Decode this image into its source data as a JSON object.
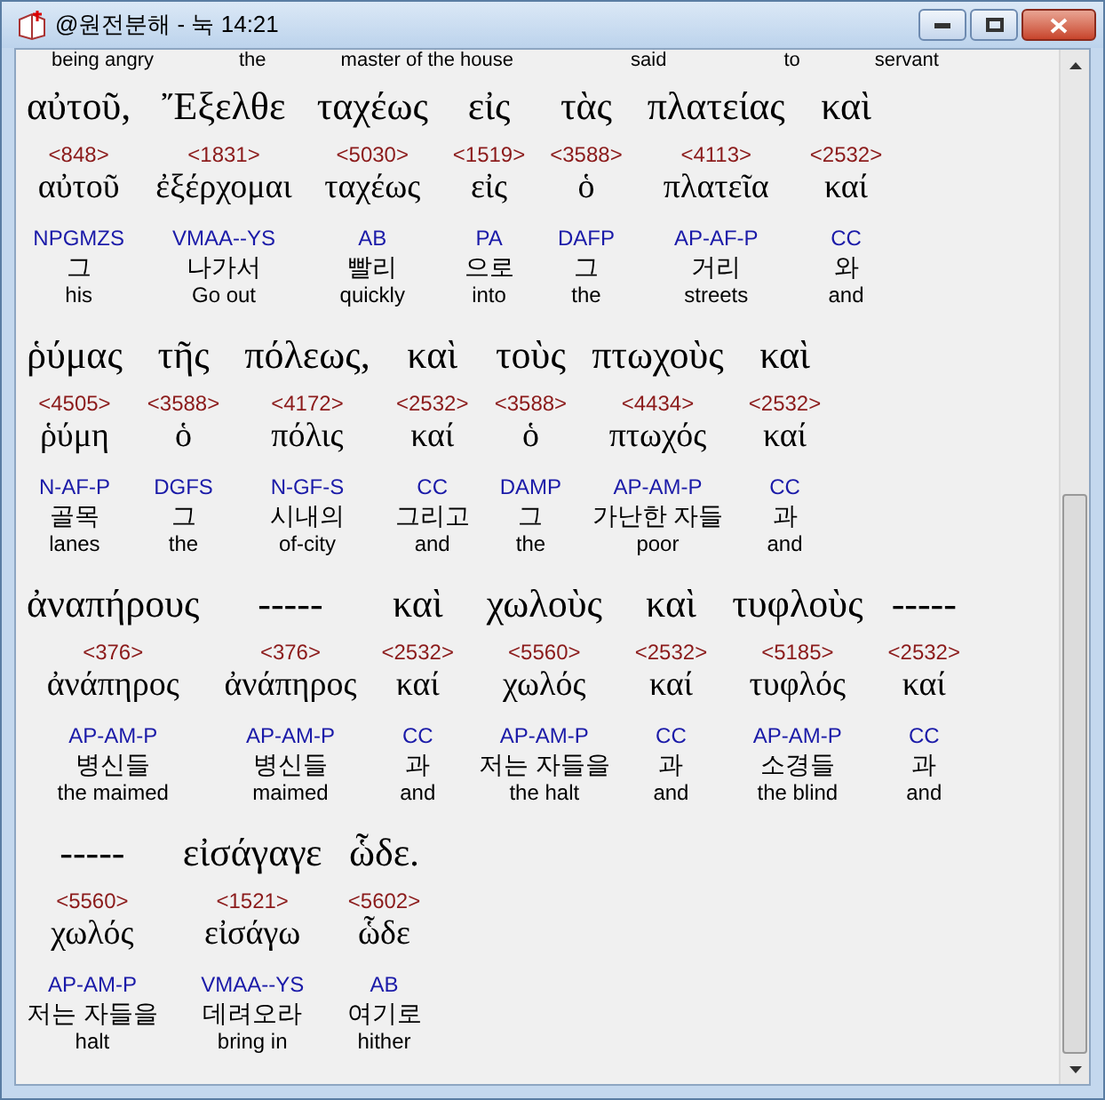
{
  "window": {
    "title": "@원전분해 - 눅 14:21"
  },
  "cut_glosses": [
    "being angry",
    "the",
    "master of the house",
    "said",
    "to",
    "servant"
  ],
  "lines": [
    {
      "words": [
        {
          "greek": "αὐτοῦ,",
          "strong": "<848>",
          "lemma": "αὐτοῦ",
          "parsing": "NPGMZS",
          "korean": "그",
          "english": "his"
        },
        {
          "greek": "Ἔξελθε",
          "strong": "<1831>",
          "lemma": "ἐξέρχομαι",
          "parsing": "VMAA--YS",
          "korean": "나가서",
          "english": "Go out"
        },
        {
          "greek": "ταχέως",
          "strong": "<5030>",
          "lemma": "ταχέως",
          "parsing": "AB",
          "korean": "빨리",
          "english": "quickly"
        },
        {
          "greek": "εἰς",
          "strong": "<1519>",
          "lemma": "εἰς",
          "parsing": "PA",
          "korean": "으로",
          "english": "into"
        },
        {
          "greek": "τὰς",
          "strong": "<3588>",
          "lemma": "ὁ",
          "parsing": "DAFP",
          "korean": "그",
          "english": "the"
        },
        {
          "greek": "πλατείας",
          "strong": "<4113>",
          "lemma": "πλατεῖα",
          "parsing": "AP-AF-P",
          "korean": "거리",
          "english": "streets"
        },
        {
          "greek": "καὶ",
          "strong": "<2532>",
          "lemma": "καί",
          "parsing": "CC",
          "korean": "와",
          "english": "and"
        }
      ]
    },
    {
      "words": [
        {
          "greek": "ῥύμας",
          "strong": "<4505>",
          "lemma": "ῥύμη",
          "parsing": "N-AF-P",
          "korean": "골목",
          "english": "lanes"
        },
        {
          "greek": "τῆς",
          "strong": "<3588>",
          "lemma": "ὁ",
          "parsing": "DGFS",
          "korean": "그",
          "english": "the"
        },
        {
          "greek": "πόλεως,",
          "strong": "<4172>",
          "lemma": "πόλις",
          "parsing": "N-GF-S",
          "korean": "시내의",
          "english": "of-city"
        },
        {
          "greek": "καὶ",
          "strong": "<2532>",
          "lemma": "καί",
          "parsing": "CC",
          "korean": "그리고",
          "english": "and"
        },
        {
          "greek": "τοὺς",
          "strong": "<3588>",
          "lemma": "ὁ",
          "parsing": "DAMP",
          "korean": "그",
          "english": "the"
        },
        {
          "greek": "πτωχοὺς",
          "strong": "<4434>",
          "lemma": "πτωχός",
          "parsing": "AP-AM-P",
          "korean": "가난한 자들",
          "english": "poor"
        },
        {
          "greek": "καὶ",
          "strong": "<2532>",
          "lemma": "καί",
          "parsing": "CC",
          "korean": "과",
          "english": "and"
        }
      ]
    },
    {
      "words": [
        {
          "greek": "ἀναπήρους",
          "strong": "<376>",
          "lemma": "ἀνάπηρος",
          "parsing": "AP-AM-P",
          "korean": "병신들",
          "english": "the maimed"
        },
        {
          "greek": "-----",
          "strong": "<376>",
          "lemma": "ἀνάπηρος",
          "parsing": "AP-AM-P",
          "korean": "병신들",
          "english": "maimed"
        },
        {
          "greek": "καὶ",
          "strong": "<2532>",
          "lemma": "καί",
          "parsing": "CC",
          "korean": "과",
          "english": "and"
        },
        {
          "greek": "χωλοὺς",
          "strong": "<5560>",
          "lemma": "χωλός",
          "parsing": "AP-AM-P",
          "korean": "저는 자들을",
          "english": "the halt"
        },
        {
          "greek": "καὶ",
          "strong": "<2532>",
          "lemma": "καί",
          "parsing": "CC",
          "korean": "과",
          "english": "and"
        },
        {
          "greek": "τυφλοὺς",
          "strong": "<5185>",
          "lemma": "τυφλός",
          "parsing": "AP-AM-P",
          "korean": "소경들",
          "english": "the blind"
        },
        {
          "greek": "-----",
          "strong": "<2532>",
          "lemma": "καί",
          "parsing": "CC",
          "korean": "과",
          "english": "and"
        }
      ]
    },
    {
      "words": [
        {
          "greek": "-----",
          "strong": "<5560>",
          "lemma": "χωλός",
          "parsing": "AP-AM-P",
          "korean": "저는 자들을",
          "english": "halt"
        },
        {
          "greek": "εἰσάγαγε",
          "strong": "<1521>",
          "lemma": "εἰσάγω",
          "parsing": "VMAA--YS",
          "korean": "데려오라",
          "english": "bring in"
        },
        {
          "greek": "ὧδε.",
          "strong": "<5602>",
          "lemma": "ὧδε",
          "parsing": "AB",
          "korean": "여기로",
          "english": "hither"
        }
      ]
    }
  ]
}
